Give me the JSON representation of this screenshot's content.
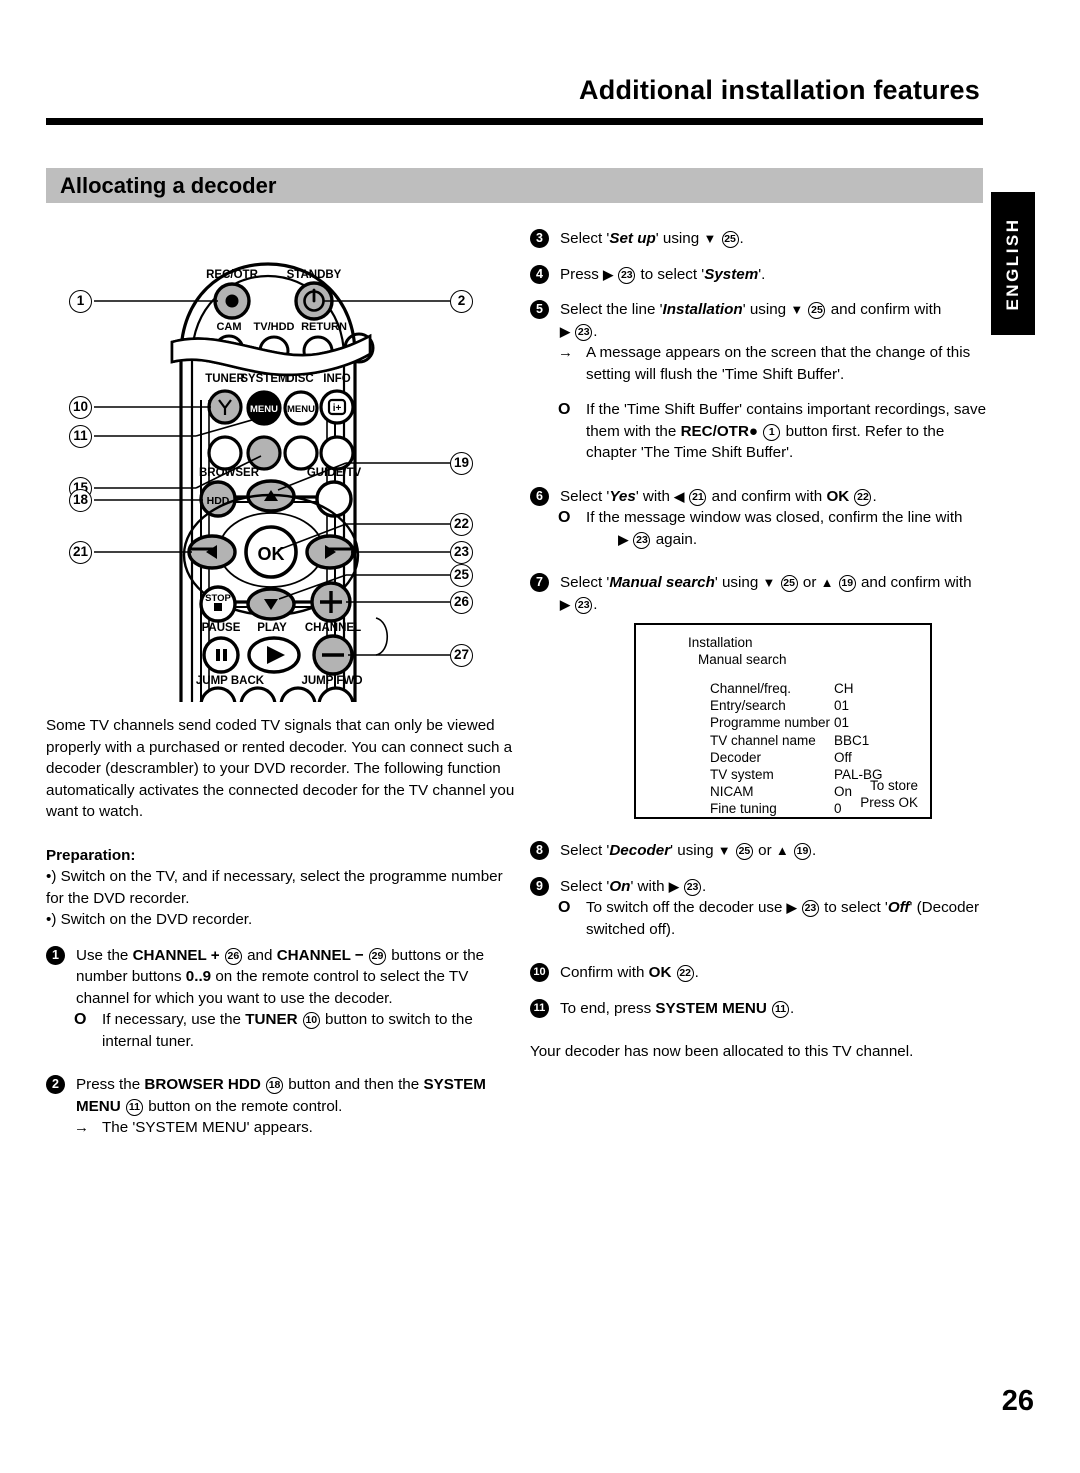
{
  "header": {
    "chapter_title": "Additional installation features",
    "section_title": "Allocating a decoder",
    "side_tab": "ENGLISH"
  },
  "footer": {
    "page_number": "26"
  },
  "remote_figure": {
    "button_labels": {
      "rec_otr": "REC/OTR",
      "standby": "STANDBY",
      "cam": "CAM",
      "tv_hdd": "TV/HDD",
      "return": "RETURN",
      "tuner": "TUNER",
      "system": "SYSTEM",
      "disc": "DISC",
      "info": "INFO",
      "menu_1": "MENU",
      "menu_2": "MENU",
      "info_glyph": "i+",
      "browser": "BROWSER",
      "hdd": "HDD",
      "guide_tv": "GUIDE/TV",
      "ok": "OK",
      "stop": "STOP",
      "pause": "PAUSE",
      "play": "PLAY",
      "channel": "CHANNEL",
      "jump_back": "JUMP BACK",
      "jump_fwd": "JUMP FWD",
      "plus": "+",
      "minus": "−"
    },
    "callouts_left": [
      "1",
      "10",
      "11",
      "15",
      "18",
      "21"
    ],
    "callouts_right": [
      "2",
      "19",
      "22",
      "23",
      "25",
      "26",
      "27"
    ]
  },
  "left_column": {
    "intro": "Some TV channels send coded TV signals that can only be viewed properly with a purchased or rented decoder. You can connect such a decoder (descrambler) to your DVD recorder. The following function automatically activates the connected decoder for the TV channel you want to watch.",
    "preparation_heading": "Preparation:",
    "prep_items": [
      "•) Switch on the TV, and if necessary, select the programme number for the DVD recorder.",
      "•) Switch on the DVD recorder."
    ],
    "step1": {
      "num": "1",
      "t1": "Use the",
      "k1": "CHANNEL +",
      "r1": "26",
      "t2": "and",
      "k2": "CHANNEL −",
      "r2": "29",
      "t3": "buttons or the number buttons",
      "k3": "0..9",
      "t4": "on the remote control to select the TV channel for which you want to use the decoder.",
      "sub": {
        "marker": "O",
        "t1": "If necessary, use the",
        "k1": "TUNER",
        "r1": "10",
        "t2": "button to switch to the internal tuner."
      }
    },
    "step2": {
      "num": "2",
      "t1": "Press the",
      "k1": "BROWSER HDD",
      "r1": "18",
      "t2": "button and then the",
      "k2": "SYSTEM MENU",
      "r2": "11",
      "t3": "button on the remote control.",
      "sub": {
        "marker": "→",
        "text": "The 'SYSTEM MENU' appears."
      }
    }
  },
  "right_column": {
    "step3": {
      "num": "3",
      "t1": "Select '",
      "em": "Set up",
      "t2": "' using",
      "glyph": "▼",
      "r1": "25",
      "t3": "."
    },
    "step4": {
      "num": "4",
      "t1": "Press",
      "glyph": "▶",
      "r1": "23",
      "t2": "to select '",
      "em": "System",
      "t3": "'."
    },
    "step5": {
      "num": "5",
      "t1": "Select the line '",
      "em": "Installation",
      "t2": "' using",
      "glyph1": "▼",
      "r1": "25",
      "t3": "and confirm with",
      "glyph2": "▶",
      "r2": "23",
      "t4": ".",
      "sub_arrow": {
        "marker": "→",
        "text": "A message appears on the screen that the change of this setting will flush the 'Time Shift Buffer'."
      },
      "sub_ring": {
        "marker": "O",
        "t1": "If the 'Time Shift Buffer' contains important recordings, save them with the",
        "k1": "REC/OTR",
        "dot": "●",
        "r1": "1",
        "t2": "button first. Refer to the chapter 'The Time Shift Buffer'."
      }
    },
    "step6": {
      "num": "6",
      "t1": "Select '",
      "em": "Yes",
      "t2": "' with",
      "glyph": "◀",
      "r1": "21",
      "t3": "and confirm with",
      "k1": "OK",
      "r2": "22",
      "t4": ".",
      "sub": {
        "marker": "O",
        "t1": "If the message window was closed, confirm the line with",
        "glyph": "▶",
        "r1": "23",
        "t2": "again."
      }
    },
    "step7": {
      "num": "7",
      "t1": "Select '",
      "em": "Manual search",
      "t2": "' using",
      "glyph1": "▼",
      "r1": "25",
      "t3": "or",
      "glyph2": "▲",
      "r2": "19",
      "t4": "and confirm with",
      "glyph3": "▶",
      "r3": "23",
      "t5": "."
    },
    "step8": {
      "num": "8",
      "t1": "Select '",
      "em": "Decoder",
      "t2": "' using",
      "glyph1": "▼",
      "r1": "25",
      "t3": "or",
      "glyph2": "▲",
      "r2": "19",
      "t4": "."
    },
    "step9": {
      "num": "9",
      "t1": "Select '",
      "em": "On",
      "t2": "' with",
      "glyph": "▶",
      "r1": "23",
      "t3": ".",
      "sub": {
        "marker": "O",
        "t1": "To switch off the decoder use",
        "glyph": "▶",
        "r1": "23",
        "t2": "to select '",
        "em": "Off",
        "t3": "' (Decoder switched off)."
      }
    },
    "step10": {
      "num": "10",
      "t1": "Confirm with",
      "k1": "OK",
      "r1": "22",
      "t2": "."
    },
    "step11": {
      "num": "11",
      "t1": "To end, press",
      "k1": "SYSTEM MENU",
      "r1": "11",
      "t2": "."
    },
    "closing": "Your decoder has now been allocated to this TV channel."
  },
  "tv_screen": {
    "title": "Installation",
    "subtitle": "Manual search",
    "rows": [
      {
        "label": "Channel/freq.",
        "value": "CH"
      },
      {
        "label": "Entry/search",
        "value": "01"
      },
      {
        "label": "Programme number",
        "value": "01"
      },
      {
        "label": "TV channel name",
        "value": "BBC1"
      },
      {
        "label": "Decoder",
        "value": "Off"
      },
      {
        "label": "TV system",
        "value": "PAL-BG"
      },
      {
        "label": "NICAM",
        "value": "On"
      },
      {
        "label": "Fine tuning",
        "value": "0"
      }
    ],
    "store_hint": "To store",
    "press_hint": "Press OK"
  }
}
